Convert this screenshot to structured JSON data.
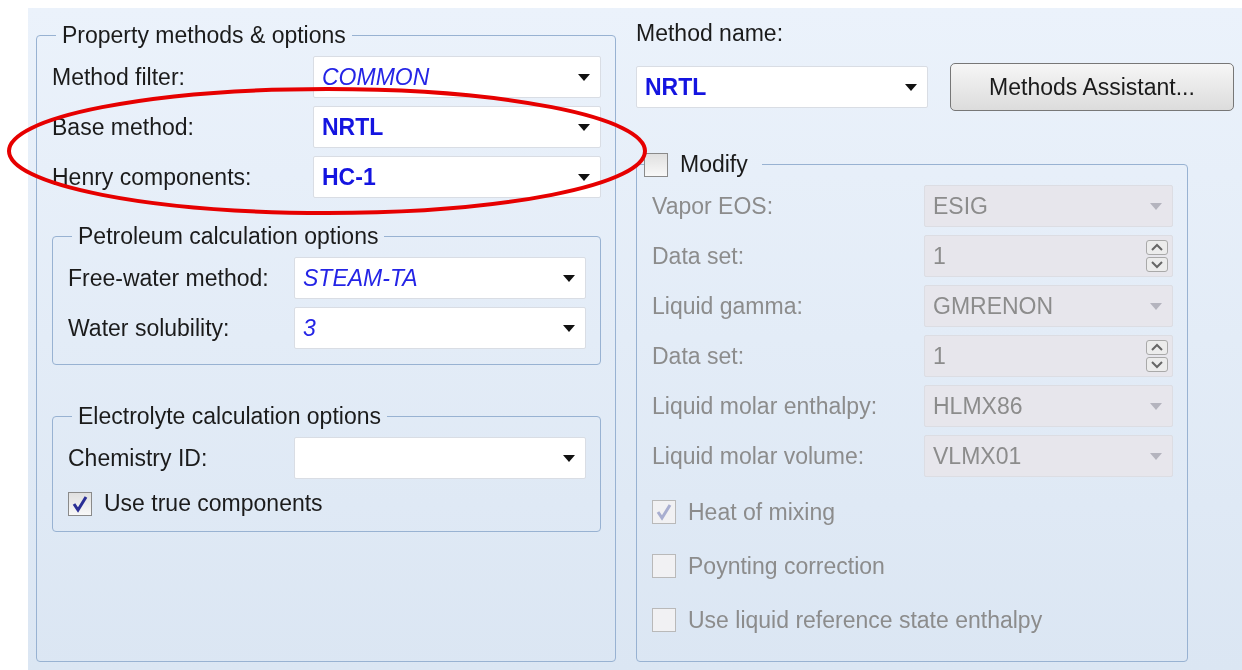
{
  "property_methods": {
    "title": "Property methods & options",
    "rows": [
      {
        "label": "Method filter:",
        "value": "COMMON",
        "italic": true,
        "bold": false
      },
      {
        "label": "Base method:",
        "value": "NRTL",
        "italic": false,
        "bold": true
      },
      {
        "label": "Henry components:",
        "value": "HC-1",
        "italic": false,
        "bold": true
      }
    ],
    "groups": [
      {
        "title": "Petroleum calculation options",
        "rows": [
          {
            "label": "Free-water method:",
            "value": "STEAM-TA",
            "italic": true,
            "bold": false
          },
          {
            "label": "Water solubility:",
            "value": "3",
            "italic": true,
            "bold": false
          }
        ]
      },
      {
        "title": "Electrolyte calculation options",
        "rows": [
          {
            "label": "Chemistry ID:"
          }
        ],
        "checkboxes": [
          {
            "label": "Use true components",
            "checked": true,
            "disabled": false
          }
        ]
      }
    ]
  },
  "method_name": {
    "label": "Method name:",
    "value": "NRTL",
    "italic": false,
    "bold": true
  },
  "assistant_button": {
    "label": "Methods Assistant..."
  },
  "modify": {
    "label": "Modify",
    "checked": false,
    "rows": [
      {
        "kind": "dropdown",
        "label": "Vapor EOS:",
        "value": "ESIG",
        "disabled": true
      },
      {
        "kind": "spinner",
        "label": "Data set:",
        "value": "1",
        "disabled": true
      },
      {
        "kind": "dropdown",
        "label": "Liquid gamma:",
        "value": "GMRENON",
        "disabled": true
      },
      {
        "kind": "spinner",
        "label": "Data set:",
        "value": "1",
        "disabled": true
      },
      {
        "kind": "dropdown",
        "label": "Liquid molar enthalpy:",
        "value": "HLMX86",
        "disabled": true
      },
      {
        "kind": "dropdown",
        "label": "Liquid molar volume:",
        "value": "VLMX01",
        "disabled": true
      }
    ],
    "checkboxes": [
      {
        "label": "Heat of mixing",
        "checked": true,
        "disabled": true
      },
      {
        "label": "Poynting correction",
        "checked": false,
        "disabled": true
      },
      {
        "label": "Use liquid reference state enthalpy",
        "checked": false,
        "disabled": true
      }
    ]
  }
}
